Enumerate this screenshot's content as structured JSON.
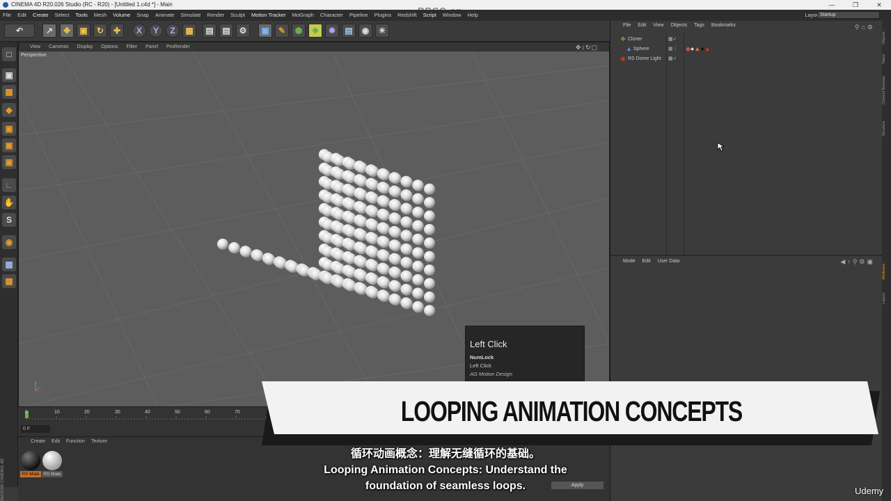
{
  "window": {
    "title": "CINEMA 4D R20.026 Studio (RC - R20) - [Untitled 1.c4d *] - Main",
    "controls": [
      "—",
      "❐",
      "✕"
    ]
  },
  "menubar": {
    "items": [
      "File",
      "Edit",
      "Create",
      "Select",
      "Tools",
      "Mesh",
      "Volume",
      "Snap",
      "Animate",
      "Simulate",
      "Render",
      "Sculpt",
      "Motion Tracker",
      "MoGraph",
      "Character",
      "Pipeline",
      "Plugins",
      "Redshift",
      "Script",
      "Window",
      "Help"
    ],
    "layout_label": "Layout:",
    "layout_value": "Startup"
  },
  "toolbar": {
    "axis_x": "X",
    "axis_y": "Y",
    "axis_z": "Z"
  },
  "viewport": {
    "menu": [
      "View",
      "Cameras",
      "Display",
      "Options",
      "Filter",
      "Panel",
      "ProRender"
    ],
    "label": "Perspective",
    "nav_icons": "✥↕↻▢"
  },
  "tooltip": {
    "title": "Left Click",
    "line1": "NumLock",
    "line2": "Left Click",
    "line3": "AG Motion Design"
  },
  "timeline": {
    "ticks": [
      "0",
      "10",
      "20",
      "30",
      "40",
      "50",
      "60",
      "70"
    ],
    "current_frame": "0 F"
  },
  "materials": {
    "menu": [
      "Create",
      "Edit",
      "Function",
      "Texture"
    ],
    "items": [
      {
        "label": "RS Mate"
      },
      {
        "label": "RS Mate"
      }
    ],
    "apply_label": "Apply"
  },
  "object_manager": {
    "menu": [
      "File",
      "Edit",
      "View",
      "Objects",
      "Tags",
      "Bookmarks"
    ],
    "objects": [
      {
        "name": "Cloner",
        "color": "#6ab04c"
      },
      {
        "name": "Sphere",
        "color": "#5b8fd9"
      },
      {
        "name": "RS Dome Light",
        "color": "#d03a2f"
      }
    ]
  },
  "attribute_manager": {
    "menu": [
      "Mode",
      "Edit",
      "User Data"
    ]
  },
  "right_tabs": [
    "Objects",
    "Takes",
    "Content Browser",
    "Structure",
    "Attributes",
    "Layers"
  ],
  "banner": {
    "text": "LOOPING ANIMATION CONCEPTS"
  },
  "subtitles": {
    "cn": "循环动画概念：理解无缝循环的基础。",
    "en1": "Looping Animation Concepts: Understand the",
    "en2": "foundation of seamless loops."
  },
  "watermarks": {
    "top": "RRCG.cn",
    "brand": "Udemy",
    "maxon": "MAXON CINEMA 4D"
  },
  "colors": {
    "accent_orange": "#e39b2b",
    "banner_bg": "#f2f2f2",
    "banner_shadow": "#1a1a1a"
  }
}
